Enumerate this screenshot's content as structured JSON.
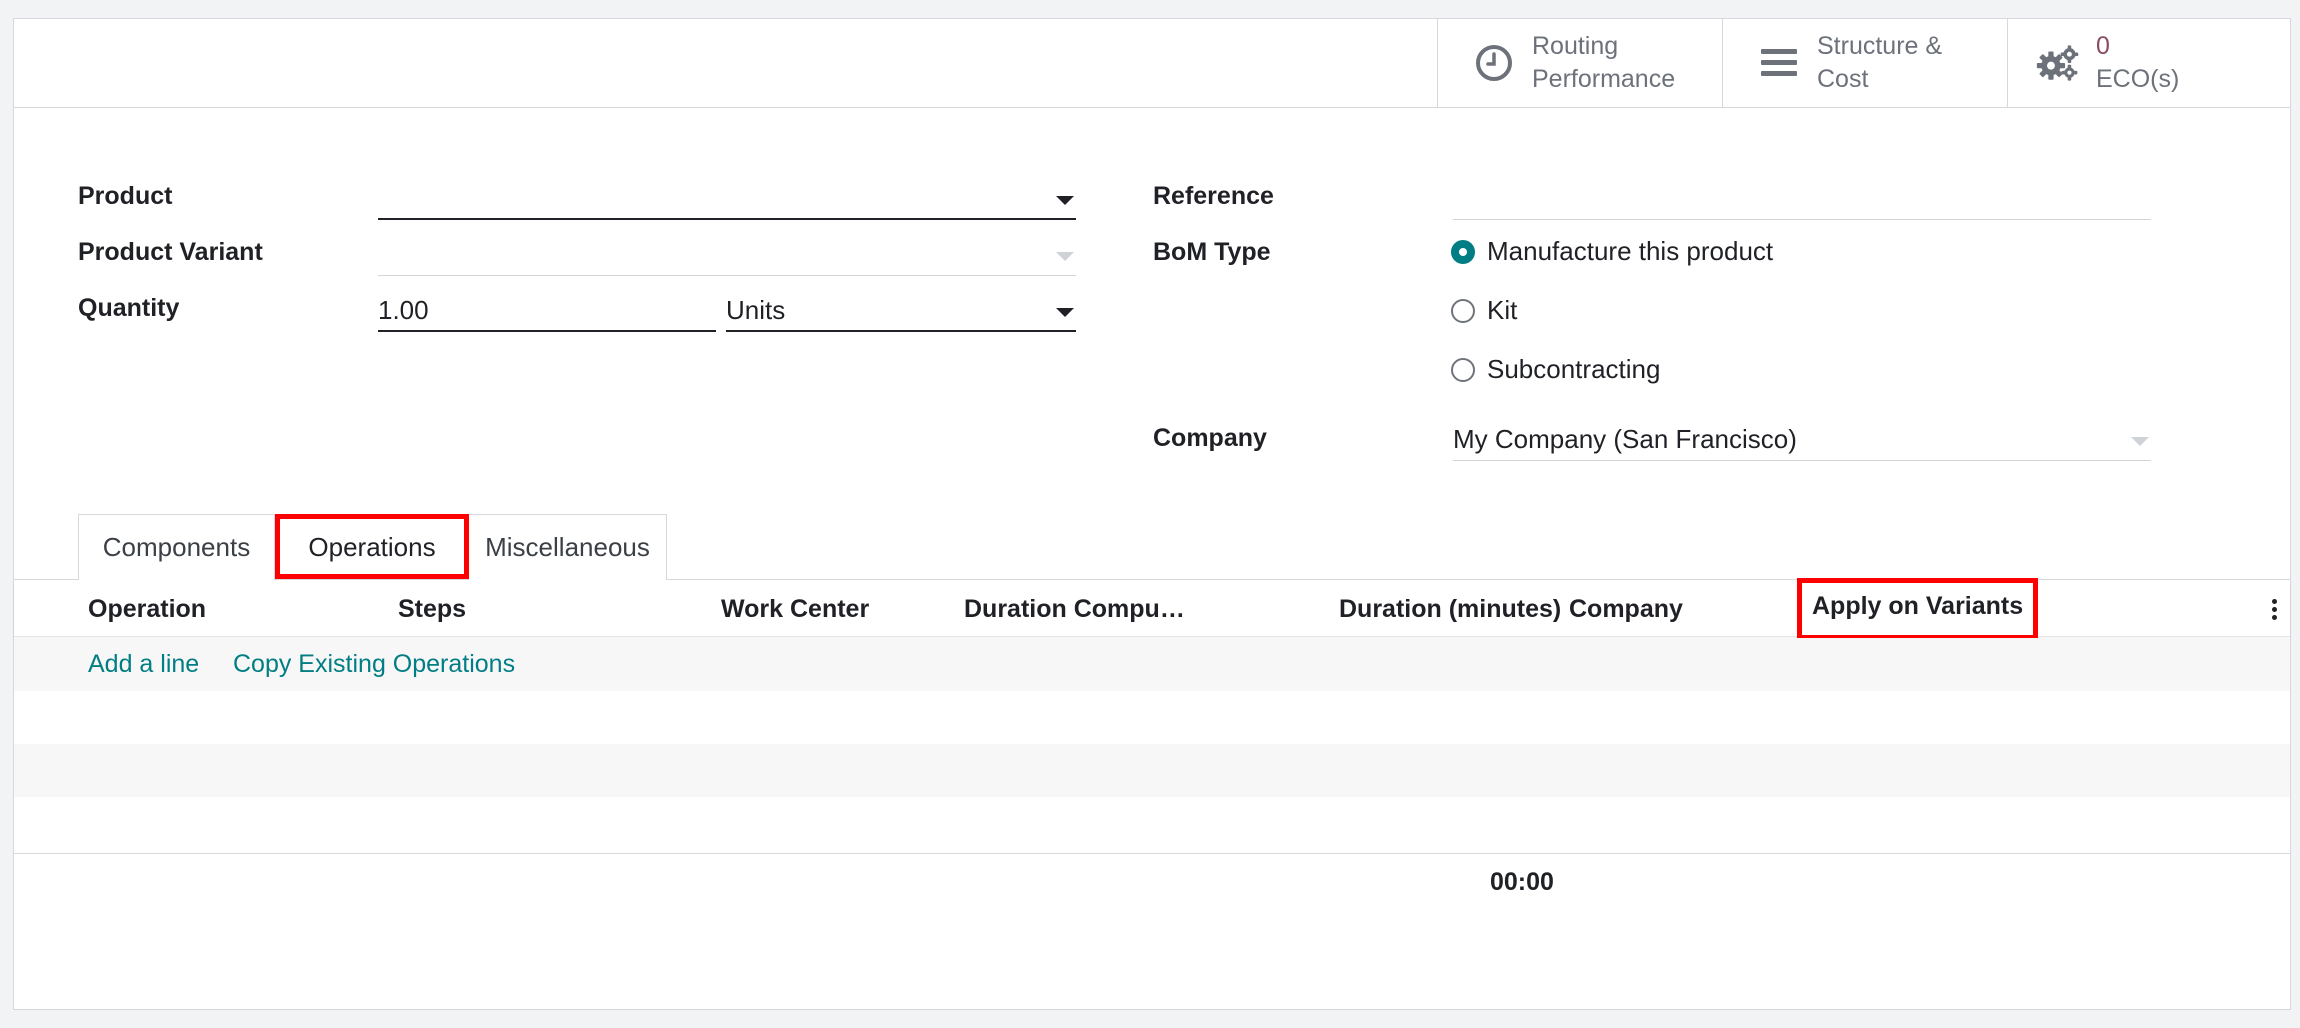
{
  "stat_buttons": {
    "routing": {
      "line1": "Routing",
      "line2": "Performance",
      "icon": "clock-icon"
    },
    "structure": {
      "line1": "Structure &",
      "line2": "Cost",
      "icon": "bars-icon"
    },
    "eco": {
      "count": "0",
      "label": "ECO(s)",
      "icon": "gears-icon"
    }
  },
  "form": {
    "product": {
      "label": "Product",
      "value": ""
    },
    "product_variant": {
      "label": "Product Variant",
      "value": ""
    },
    "quantity": {
      "label": "Quantity",
      "value": "1.00",
      "uom": "Units"
    },
    "reference": {
      "label": "Reference",
      "value": ""
    },
    "bom_type": {
      "label": "BoM Type",
      "options": [
        "Manufacture this product",
        "Kit",
        "Subcontracting"
      ],
      "selected": "Manufacture this product"
    },
    "company": {
      "label": "Company",
      "value": "My Company (San Francisco)"
    }
  },
  "tabs": [
    "Components",
    "Operations",
    "Miscellaneous"
  ],
  "active_tab": "Operations",
  "table": {
    "headers": [
      "Operation",
      "Steps",
      "Work Center",
      "Duration Compu…",
      "Duration (minutes)",
      "Company",
      "Apply on Variants"
    ],
    "add_line": "Add a line",
    "copy_existing": "Copy Existing Operations",
    "total_duration": "00:00"
  },
  "colors": {
    "accent": "#017e84",
    "highlight": "#ff0000",
    "eco_count": "#8a4b63"
  }
}
